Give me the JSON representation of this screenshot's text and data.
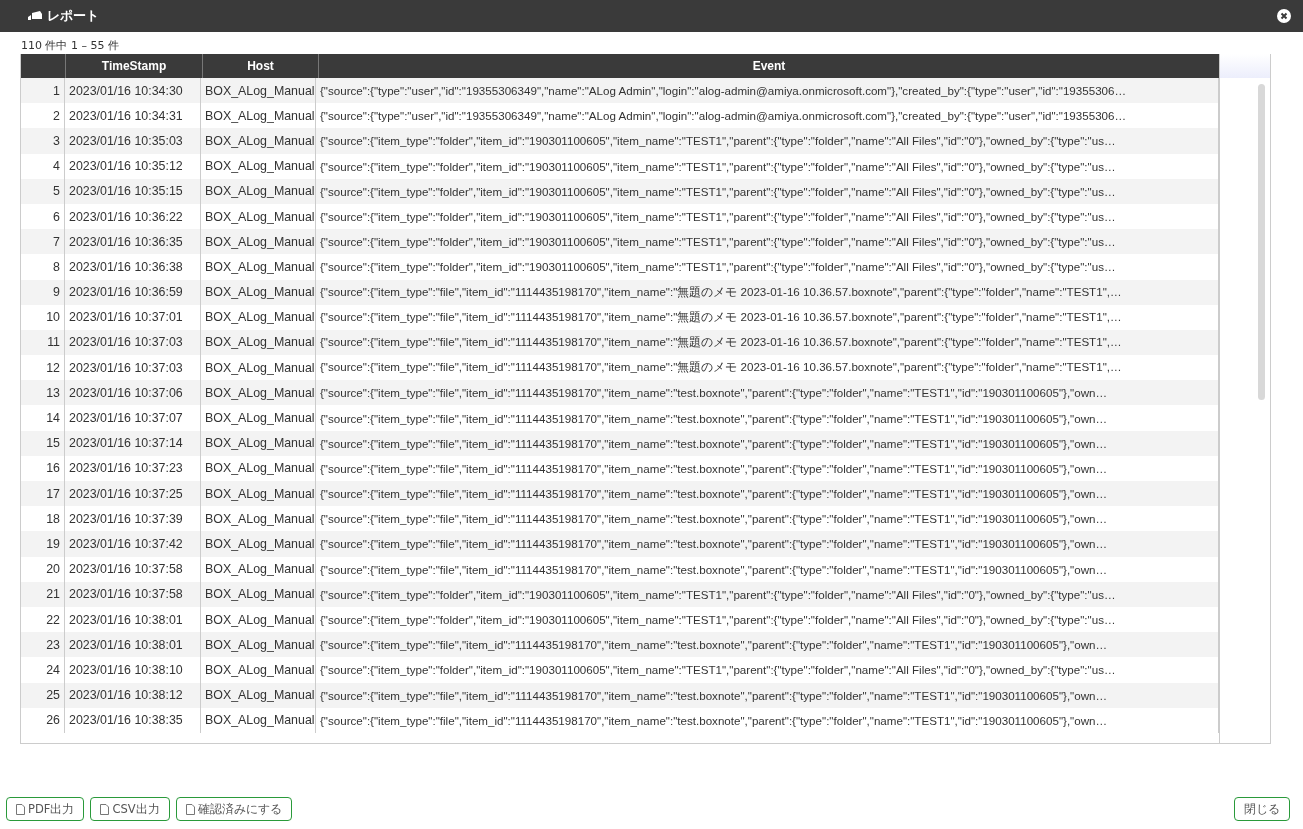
{
  "window": {
    "title": "レポート"
  },
  "count": "110 件中 1 – 55 件",
  "table": {
    "columns": [
      "TimeStamp",
      "Host",
      "Event"
    ],
    "rows": [
      {
        "no": "1",
        "timestamp": "2023/01/16 10:34:30",
        "host": "BOX_ALog_Manual",
        "event": "{\"source\":{\"type\":\"user\",\"id\":\"19355306349\",\"name\":\"ALog Admin\",\"login\":\"alog-admin@amiya.onmicrosoft.com\"},\"created_by\":{\"type\":\"user\",\"id\":\"19355306…"
      },
      {
        "no": "2",
        "timestamp": "2023/01/16 10:34:31",
        "host": "BOX_ALog_Manual",
        "event": "{\"source\":{\"type\":\"user\",\"id\":\"19355306349\",\"name\":\"ALog Admin\",\"login\":\"alog-admin@amiya.onmicrosoft.com\"},\"created_by\":{\"type\":\"user\",\"id\":\"19355306…"
      },
      {
        "no": "3",
        "timestamp": "2023/01/16 10:35:03",
        "host": "BOX_ALog_Manual",
        "event": "{\"source\":{\"item_type\":\"folder\",\"item_id\":\"190301100605\",\"item_name\":\"TEST1\",\"parent\":{\"type\":\"folder\",\"name\":\"All Files\",\"id\":\"0\"},\"owned_by\":{\"type\":\"us…"
      },
      {
        "no": "4",
        "timestamp": "2023/01/16 10:35:12",
        "host": "BOX_ALog_Manual",
        "event": "{\"source\":{\"item_type\":\"folder\",\"item_id\":\"190301100605\",\"item_name\":\"TEST1\",\"parent\":{\"type\":\"folder\",\"name\":\"All Files\",\"id\":\"0\"},\"owned_by\":{\"type\":\"us…"
      },
      {
        "no": "5",
        "timestamp": "2023/01/16 10:35:15",
        "host": "BOX_ALog_Manual",
        "event": "{\"source\":{\"item_type\":\"folder\",\"item_id\":\"190301100605\",\"item_name\":\"TEST1\",\"parent\":{\"type\":\"folder\",\"name\":\"All Files\",\"id\":\"0\"},\"owned_by\":{\"type\":\"us…"
      },
      {
        "no": "6",
        "timestamp": "2023/01/16 10:36:22",
        "host": "BOX_ALog_Manual",
        "event": "{\"source\":{\"item_type\":\"folder\",\"item_id\":\"190301100605\",\"item_name\":\"TEST1\",\"parent\":{\"type\":\"folder\",\"name\":\"All Files\",\"id\":\"0\"},\"owned_by\":{\"type\":\"us…"
      },
      {
        "no": "7",
        "timestamp": "2023/01/16 10:36:35",
        "host": "BOX_ALog_Manual",
        "event": "{\"source\":{\"item_type\":\"folder\",\"item_id\":\"190301100605\",\"item_name\":\"TEST1\",\"parent\":{\"type\":\"folder\",\"name\":\"All Files\",\"id\":\"0\"},\"owned_by\":{\"type\":\"us…"
      },
      {
        "no": "8",
        "timestamp": "2023/01/16 10:36:38",
        "host": "BOX_ALog_Manual",
        "event": "{\"source\":{\"item_type\":\"folder\",\"item_id\":\"190301100605\",\"item_name\":\"TEST1\",\"parent\":{\"type\":\"folder\",\"name\":\"All Files\",\"id\":\"0\"},\"owned_by\":{\"type\":\"us…"
      },
      {
        "no": "9",
        "timestamp": "2023/01/16 10:36:59",
        "host": "BOX_ALog_Manual",
        "event": "{\"source\":{\"item_type\":\"file\",\"item_id\":\"1114435198170\",\"item_name\":\"無題のメモ 2023-01-16 10.36.57.boxnote\",\"parent\":{\"type\":\"folder\",\"name\":\"TEST1\",…"
      },
      {
        "no": "10",
        "timestamp": "2023/01/16 10:37:01",
        "host": "BOX_ALog_Manual",
        "event": "{\"source\":{\"item_type\":\"file\",\"item_id\":\"1114435198170\",\"item_name\":\"無題のメモ 2023-01-16 10.36.57.boxnote\",\"parent\":{\"type\":\"folder\",\"name\":\"TEST1\",…"
      },
      {
        "no": "11",
        "timestamp": "2023/01/16 10:37:03",
        "host": "BOX_ALog_Manual",
        "event": "{\"source\":{\"item_type\":\"file\",\"item_id\":\"1114435198170\",\"item_name\":\"無題のメモ 2023-01-16 10.36.57.boxnote\",\"parent\":{\"type\":\"folder\",\"name\":\"TEST1\",…"
      },
      {
        "no": "12",
        "timestamp": "2023/01/16 10:37:03",
        "host": "BOX_ALog_Manual",
        "event": "{\"source\":{\"item_type\":\"file\",\"item_id\":\"1114435198170\",\"item_name\":\"無題のメモ 2023-01-16 10.36.57.boxnote\",\"parent\":{\"type\":\"folder\",\"name\":\"TEST1\",…"
      },
      {
        "no": "13",
        "timestamp": "2023/01/16 10:37:06",
        "host": "BOX_ALog_Manual",
        "event": "{\"source\":{\"item_type\":\"file\",\"item_id\":\"1114435198170\",\"item_name\":\"test.boxnote\",\"parent\":{\"type\":\"folder\",\"name\":\"TEST1\",\"id\":\"190301100605\"},\"own…"
      },
      {
        "no": "14",
        "timestamp": "2023/01/16 10:37:07",
        "host": "BOX_ALog_Manual",
        "event": "{\"source\":{\"item_type\":\"file\",\"item_id\":\"1114435198170\",\"item_name\":\"test.boxnote\",\"parent\":{\"type\":\"folder\",\"name\":\"TEST1\",\"id\":\"190301100605\"},\"own…"
      },
      {
        "no": "15",
        "timestamp": "2023/01/16 10:37:14",
        "host": "BOX_ALog_Manual",
        "event": "{\"source\":{\"item_type\":\"file\",\"item_id\":\"1114435198170\",\"item_name\":\"test.boxnote\",\"parent\":{\"type\":\"folder\",\"name\":\"TEST1\",\"id\":\"190301100605\"},\"own…"
      },
      {
        "no": "16",
        "timestamp": "2023/01/16 10:37:23",
        "host": "BOX_ALog_Manual",
        "event": "{\"source\":{\"item_type\":\"file\",\"item_id\":\"1114435198170\",\"item_name\":\"test.boxnote\",\"parent\":{\"type\":\"folder\",\"name\":\"TEST1\",\"id\":\"190301100605\"},\"own…"
      },
      {
        "no": "17",
        "timestamp": "2023/01/16 10:37:25",
        "host": "BOX_ALog_Manual",
        "event": "{\"source\":{\"item_type\":\"file\",\"item_id\":\"1114435198170\",\"item_name\":\"test.boxnote\",\"parent\":{\"type\":\"folder\",\"name\":\"TEST1\",\"id\":\"190301100605\"},\"own…"
      },
      {
        "no": "18",
        "timestamp": "2023/01/16 10:37:39",
        "host": "BOX_ALog_Manual",
        "event": "{\"source\":{\"item_type\":\"file\",\"item_id\":\"1114435198170\",\"item_name\":\"test.boxnote\",\"parent\":{\"type\":\"folder\",\"name\":\"TEST1\",\"id\":\"190301100605\"},\"own…"
      },
      {
        "no": "19",
        "timestamp": "2023/01/16 10:37:42",
        "host": "BOX_ALog_Manual",
        "event": "{\"source\":{\"item_type\":\"file\",\"item_id\":\"1114435198170\",\"item_name\":\"test.boxnote\",\"parent\":{\"type\":\"folder\",\"name\":\"TEST1\",\"id\":\"190301100605\"},\"own…"
      },
      {
        "no": "20",
        "timestamp": "2023/01/16 10:37:58",
        "host": "BOX_ALog_Manual",
        "event": "{\"source\":{\"item_type\":\"file\",\"item_id\":\"1114435198170\",\"item_name\":\"test.boxnote\",\"parent\":{\"type\":\"folder\",\"name\":\"TEST1\",\"id\":\"190301100605\"},\"own…"
      },
      {
        "no": "21",
        "timestamp": "2023/01/16 10:37:58",
        "host": "BOX_ALog_Manual",
        "event": "{\"source\":{\"item_type\":\"folder\",\"item_id\":\"190301100605\",\"item_name\":\"TEST1\",\"parent\":{\"type\":\"folder\",\"name\":\"All Files\",\"id\":\"0\"},\"owned_by\":{\"type\":\"us…"
      },
      {
        "no": "22",
        "timestamp": "2023/01/16 10:38:01",
        "host": "BOX_ALog_Manual",
        "event": "{\"source\":{\"item_type\":\"folder\",\"item_id\":\"190301100605\",\"item_name\":\"TEST1\",\"parent\":{\"type\":\"folder\",\"name\":\"All Files\",\"id\":\"0\"},\"owned_by\":{\"type\":\"us…"
      },
      {
        "no": "23",
        "timestamp": "2023/01/16 10:38:01",
        "host": "BOX_ALog_Manual",
        "event": "{\"source\":{\"item_type\":\"file\",\"item_id\":\"1114435198170\",\"item_name\":\"test.boxnote\",\"parent\":{\"type\":\"folder\",\"name\":\"TEST1\",\"id\":\"190301100605\"},\"own…"
      },
      {
        "no": "24",
        "timestamp": "2023/01/16 10:38:10",
        "host": "BOX_ALog_Manual",
        "event": "{\"source\":{\"item_type\":\"folder\",\"item_id\":\"190301100605\",\"item_name\":\"TEST1\",\"parent\":{\"type\":\"folder\",\"name\":\"All Files\",\"id\":\"0\"},\"owned_by\":{\"type\":\"us…"
      },
      {
        "no": "25",
        "timestamp": "2023/01/16 10:38:12",
        "host": "BOX_ALog_Manual",
        "event": "{\"source\":{\"item_type\":\"file\",\"item_id\":\"1114435198170\",\"item_name\":\"test.boxnote\",\"parent\":{\"type\":\"folder\",\"name\":\"TEST1\",\"id\":\"190301100605\"},\"own…"
      },
      {
        "no": "26",
        "timestamp": "2023/01/16 10:38:35",
        "host": "BOX_ALog_Manual",
        "event": "{\"source\":{\"item_type\":\"file\",\"item_id\":\"1114435198170\",\"item_name\":\"test.boxnote\",\"parent\":{\"type\":\"folder\",\"name\":\"TEST1\",\"id\":\"190301100605\"},\"own…"
      }
    ]
  },
  "buttons": [
    "PDF出力",
    "CSV出力",
    "確認済みにする"
  ],
  "close_button": "閉じる"
}
